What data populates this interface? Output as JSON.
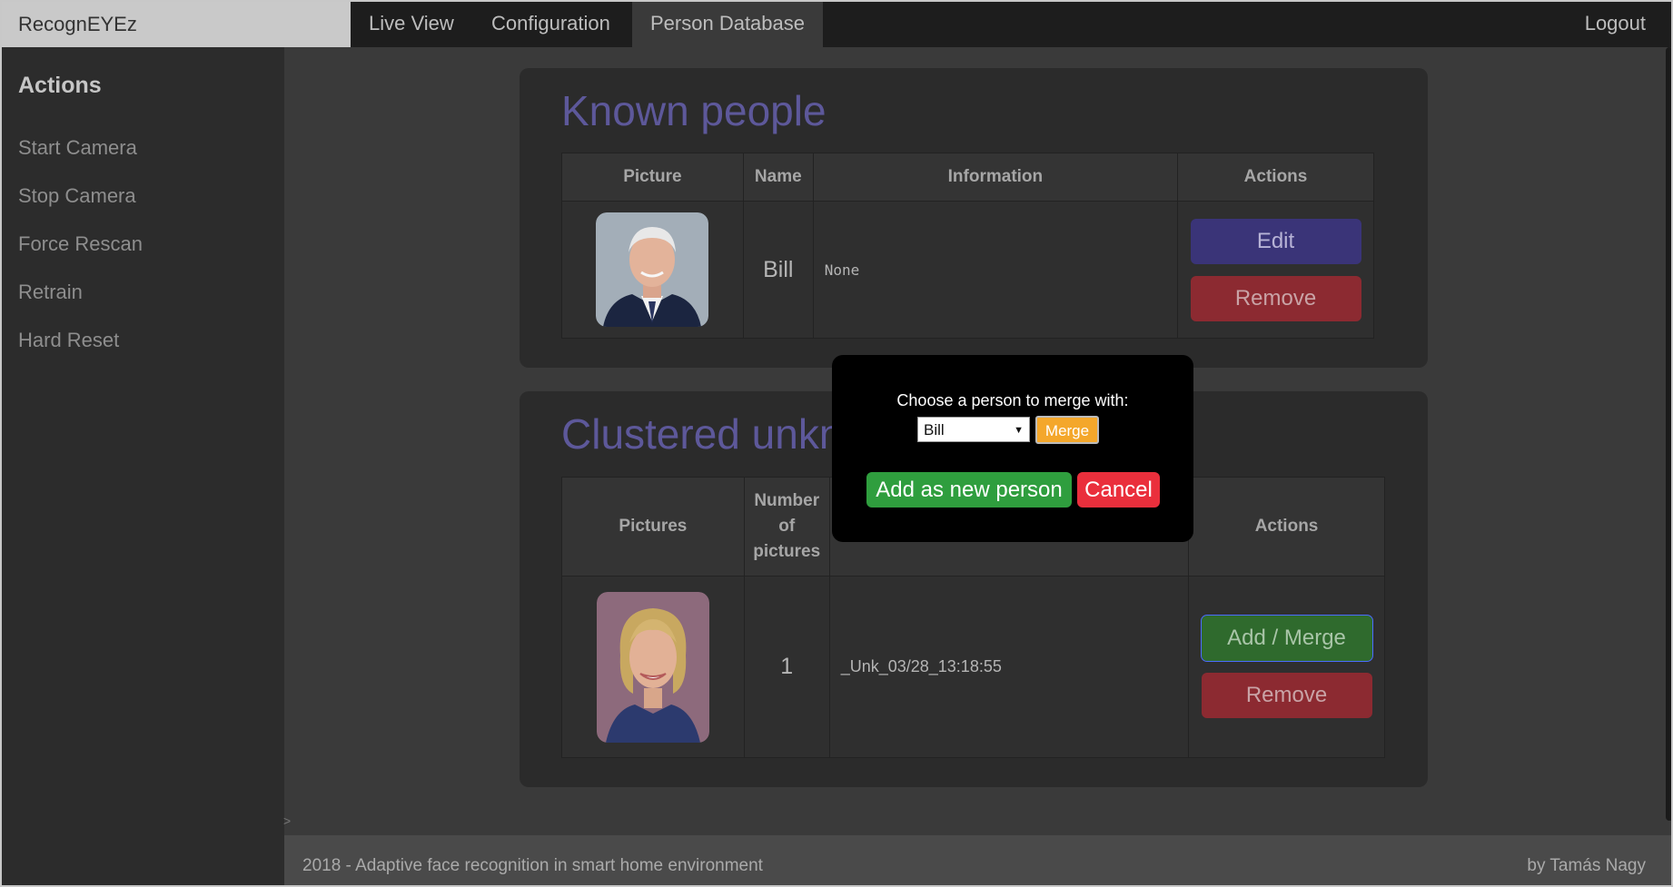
{
  "nav": {
    "brand": "RecognEYEz",
    "links": [
      "Live View",
      "Configuration",
      "Person Database"
    ],
    "active": "Person Database",
    "logout": "Logout"
  },
  "sidebar": {
    "title": "Actions",
    "items": [
      "Start Camera",
      "Stop Camera",
      "Force Rescan",
      "Retrain",
      "Hard Reset"
    ],
    "handle": ">"
  },
  "known": {
    "title": "Known people",
    "columns": [
      "Picture",
      "Name",
      "Information",
      "Actions"
    ],
    "rows": [
      {
        "name": "Bill",
        "information": "None",
        "edit_label": "Edit",
        "remove_label": "Remove"
      }
    ]
  },
  "clustered": {
    "title": "Clustered unkn",
    "columns": [
      "Pictures",
      "Number of pictures",
      "",
      "Actions"
    ],
    "columns_lines": [
      "Number",
      "of",
      "pictures"
    ],
    "rows": [
      {
        "count": "1",
        "id": "_Unk_03/28_13:18:55",
        "merge_label": "Add / Merge",
        "remove_label": "Remove"
      }
    ]
  },
  "modal": {
    "label": "Choose a person to merge with:",
    "selected": "Bill",
    "merge_label": "Merge",
    "new_label": "Add as new person",
    "cancel_label": "Cancel"
  },
  "footer": {
    "left": "2018 - Adaptive face recognition in smart home environment",
    "right": "by Tamás Nagy"
  },
  "colors": {
    "title": "#5d589a",
    "edit": "#3a3478",
    "remove": "#8c2a31",
    "merge_green": "#2f6a2d",
    "modal_merge": "#f4a72b",
    "modal_new": "#2f9e3e",
    "modal_cancel": "#ea2f3c"
  }
}
